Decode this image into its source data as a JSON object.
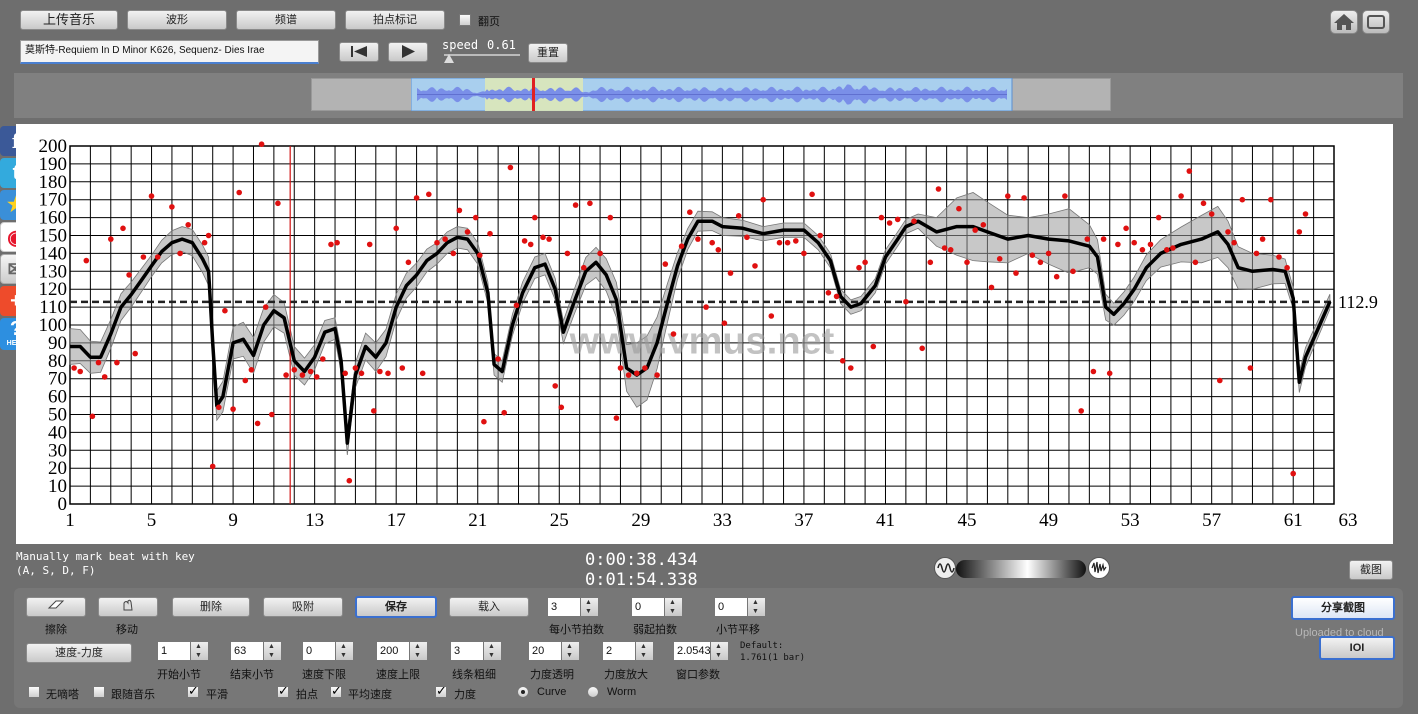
{
  "toolbar": {
    "upload_label": "上传音乐",
    "waveform_label": "波形",
    "spectrum_label": "频谱",
    "tap_mark_label": "拍点标记",
    "page_flip_label": "翻页",
    "song_title": "莫斯特-Requiem In D Minor K626, Sequenz- Dies Irae",
    "speed_label": "speed",
    "speed_value": "0.61",
    "reset_label": "重置"
  },
  "chart_data": {
    "type": "scatter",
    "title": "",
    "xlabel": "",
    "ylabel": "",
    "xlim": [
      1,
      63
    ],
    "ylim": [
      0,
      200
    ],
    "x_ticks": [
      1,
      5,
      9,
      13,
      17,
      21,
      25,
      29,
      33,
      37,
      41,
      45,
      49,
      53,
      57,
      61,
      63
    ],
    "y_ticks": [
      0,
      10,
      20,
      30,
      40,
      50,
      60,
      70,
      80,
      90,
      100,
      110,
      120,
      130,
      140,
      150,
      160,
      170,
      180,
      190,
      200
    ],
    "mean_line": 112.9,
    "mean_label": "112.9",
    "cursor_x": 11.8,
    "watermark": "www.vmus.net",
    "smooth_curve": [
      [
        1,
        88
      ],
      [
        1.5,
        88
      ],
      [
        2,
        82
      ],
      [
        2.5,
        82
      ],
      [
        3,
        95
      ],
      [
        3.5,
        110
      ],
      [
        4,
        117
      ],
      [
        4.5,
        125
      ],
      [
        5,
        133
      ],
      [
        5.5,
        141
      ],
      [
        6,
        146
      ],
      [
        6.5,
        148
      ],
      [
        7,
        146
      ],
      [
        7.5,
        137
      ],
      [
        7.8,
        130
      ],
      [
        8,
        90
      ],
      [
        8.2,
        55
      ],
      [
        8.5,
        60
      ],
      [
        9,
        90
      ],
      [
        9.5,
        92
      ],
      [
        10,
        83
      ],
      [
        10.5,
        100
      ],
      [
        11,
        108
      ],
      [
        11.5,
        104
      ],
      [
        12,
        80
      ],
      [
        12.5,
        74
      ],
      [
        13,
        82
      ],
      [
        13.5,
        96
      ],
      [
        14,
        98
      ],
      [
        14.3,
        80
      ],
      [
        14.6,
        34
      ],
      [
        15,
        72
      ],
      [
        15.5,
        88
      ],
      [
        16,
        82
      ],
      [
        16.5,
        90
      ],
      [
        17,
        110
      ],
      [
        17.5,
        122
      ],
      [
        18,
        128
      ],
      [
        18.5,
        136
      ],
      [
        19,
        140
      ],
      [
        19.5,
        146
      ],
      [
        20,
        149
      ],
      [
        20.5,
        148
      ],
      [
        21,
        140
      ],
      [
        21.5,
        118
      ],
      [
        21.8,
        78
      ],
      [
        22.2,
        74
      ],
      [
        22.7,
        100
      ],
      [
        23.2,
        118
      ],
      [
        23.8,
        132
      ],
      [
        24.3,
        134
      ],
      [
        24.8,
        120
      ],
      [
        25.2,
        96
      ],
      [
        25.7,
        112
      ],
      [
        26.3,
        130
      ],
      [
        26.8,
        135
      ],
      [
        27.3,
        128
      ],
      [
        27.8,
        114
      ],
      [
        28.3,
        76
      ],
      [
        28.8,
        72
      ],
      [
        29.3,
        76
      ],
      [
        29.8,
        90
      ],
      [
        30.3,
        112
      ],
      [
        30.8,
        133
      ],
      [
        31.3,
        148
      ],
      [
        31.8,
        158
      ],
      [
        32.5,
        158
      ],
      [
        33,
        155
      ],
      [
        34,
        154
      ],
      [
        35,
        151
      ],
      [
        36,
        153
      ],
      [
        37,
        153
      ],
      [
        37.7,
        146
      ],
      [
        38.3,
        136
      ],
      [
        38.8,
        116
      ],
      [
        39.3,
        110
      ],
      [
        39.8,
        112
      ],
      [
        40.5,
        122
      ],
      [
        41,
        138
      ],
      [
        41.6,
        148
      ],
      [
        42,
        155
      ],
      [
        42.6,
        158
      ],
      [
        43.5,
        152
      ],
      [
        44.5,
        155
      ],
      [
        45.3,
        155
      ],
      [
        46,
        152
      ],
      [
        47,
        148
      ],
      [
        48,
        150
      ],
      [
        49,
        148
      ],
      [
        50,
        147
      ],
      [
        51,
        144
      ],
      [
        51.4,
        138
      ],
      [
        51.8,
        110
      ],
      [
        52.2,
        106
      ],
      [
        52.7,
        112
      ],
      [
        53.2,
        120
      ],
      [
        53.8,
        132
      ],
      [
        54.5,
        140
      ],
      [
        55.5,
        145
      ],
      [
        56.5,
        148
      ],
      [
        57.3,
        152
      ],
      [
        57.8,
        145
      ],
      [
        58.3,
        132
      ],
      [
        59,
        130
      ],
      [
        60,
        131
      ],
      [
        60.6,
        130
      ],
      [
        61,
        115
      ],
      [
        61.3,
        68
      ],
      [
        61.6,
        82
      ],
      [
        62.3,
        100
      ],
      [
        62.8,
        113
      ]
    ],
    "band_half_width": [
      [
        1,
        10
      ],
      [
        5,
        6
      ],
      [
        8,
        8
      ],
      [
        10,
        10
      ],
      [
        12,
        8
      ],
      [
        14,
        6
      ],
      [
        16,
        8
      ],
      [
        19,
        6
      ],
      [
        21,
        6
      ],
      [
        23,
        6
      ],
      [
        25,
        6
      ],
      [
        28,
        10
      ],
      [
        29,
        20
      ],
      [
        31,
        6
      ],
      [
        35,
        4
      ],
      [
        38,
        4
      ],
      [
        41,
        4
      ],
      [
        43,
        4
      ],
      [
        45,
        20
      ],
      [
        48,
        10
      ],
      [
        50,
        18
      ],
      [
        52,
        6
      ],
      [
        55,
        8
      ],
      [
        57,
        15
      ],
      [
        59,
        10
      ],
      [
        61,
        6
      ],
      [
        63,
        4
      ]
    ],
    "points": [
      [
        1.2,
        76
      ],
      [
        1.5,
        74
      ],
      [
        1.8,
        136
      ],
      [
        2.1,
        49
      ],
      [
        2.4,
        79
      ],
      [
        2.7,
        71
      ],
      [
        3.0,
        148
      ],
      [
        3.3,
        79
      ],
      [
        3.6,
        154
      ],
      [
        3.9,
        128
      ],
      [
        4.2,
        84
      ],
      [
        4.6,
        138
      ],
      [
        5.0,
        172
      ],
      [
        5.3,
        138
      ],
      [
        6.0,
        166
      ],
      [
        6.4,
        140
      ],
      [
        6.8,
        156
      ],
      [
        7.6,
        146
      ],
      [
        7.8,
        150
      ],
      [
        8.0,
        21
      ],
      [
        8.3,
        54
      ],
      [
        8.6,
        108
      ],
      [
        9.0,
        53
      ],
      [
        9.3,
        174
      ],
      [
        9.6,
        69
      ],
      [
        9.9,
        75
      ],
      [
        10.2,
        45
      ],
      [
        10.4,
        201
      ],
      [
        10.6,
        110
      ],
      [
        10.9,
        50
      ],
      [
        11.2,
        168
      ],
      [
        11.6,
        72
      ],
      [
        12.0,
        75
      ],
      [
        12.4,
        72
      ],
      [
        12.8,
        74
      ],
      [
        13.1,
        71
      ],
      [
        13.4,
        81
      ],
      [
        13.8,
        145
      ],
      [
        14.1,
        146
      ],
      [
        14.5,
        73
      ],
      [
        14.7,
        13
      ],
      [
        15.0,
        76
      ],
      [
        15.3,
        73
      ],
      [
        15.7,
        145
      ],
      [
        15.9,
        52
      ],
      [
        16.2,
        74
      ],
      [
        16.6,
        73
      ],
      [
        17.0,
        154
      ],
      [
        17.3,
        76
      ],
      [
        17.6,
        135
      ],
      [
        18.0,
        171
      ],
      [
        18.3,
        73
      ],
      [
        18.6,
        173
      ],
      [
        19.0,
        146
      ],
      [
        19.4,
        148
      ],
      [
        19.8,
        140
      ],
      [
        20.1,
        164
      ],
      [
        20.5,
        152
      ],
      [
        20.9,
        160
      ],
      [
        21.1,
        139
      ],
      [
        21.3,
        46
      ],
      [
        21.6,
        151
      ],
      [
        22.0,
        81
      ],
      [
        22.3,
        51
      ],
      [
        22.6,
        188
      ],
      [
        22.9,
        111
      ],
      [
        23.3,
        147
      ],
      [
        23.6,
        145
      ],
      [
        23.8,
        160
      ],
      [
        24.2,
        149
      ],
      [
        24.5,
        148
      ],
      [
        24.8,
        66
      ],
      [
        25.1,
        54
      ],
      [
        25.4,
        140
      ],
      [
        25.8,
        167
      ],
      [
        26.2,
        132
      ],
      [
        26.5,
        168
      ],
      [
        27.0,
        140
      ],
      [
        27.5,
        160
      ],
      [
        27.8,
        48
      ],
      [
        28.0,
        76
      ],
      [
        28.4,
        72
      ],
      [
        28.8,
        73
      ],
      [
        29.2,
        76
      ],
      [
        29.8,
        72
      ],
      [
        30.2,
        134
      ],
      [
        30.6,
        95
      ],
      [
        31.0,
        144
      ],
      [
        31.4,
        163
      ],
      [
        31.8,
        148
      ],
      [
        32.2,
        110
      ],
      [
        32.5,
        146
      ],
      [
        32.8,
        142
      ],
      [
        33.1,
        101
      ],
      [
        33.4,
        129
      ],
      [
        33.8,
        161
      ],
      [
        34.2,
        149
      ],
      [
        34.6,
        133
      ],
      [
        35.0,
        170
      ],
      [
        35.4,
        105
      ],
      [
        35.8,
        146
      ],
      [
        36.2,
        146
      ],
      [
        36.6,
        147
      ],
      [
        37.0,
        140
      ],
      [
        37.4,
        173
      ],
      [
        37.8,
        150
      ],
      [
        38.2,
        118
      ],
      [
        38.6,
        116
      ],
      [
        38.9,
        80
      ],
      [
        39.3,
        76
      ],
      [
        39.7,
        132
      ],
      [
        40.0,
        135
      ],
      [
        40.4,
        88
      ],
      [
        40.8,
        160
      ],
      [
        41.2,
        157
      ],
      [
        41.6,
        159
      ],
      [
        42.0,
        113
      ],
      [
        42.4,
        158
      ],
      [
        42.8,
        87
      ],
      [
        43.2,
        135
      ],
      [
        43.6,
        176
      ],
      [
        43.9,
        143
      ],
      [
        44.2,
        142
      ],
      [
        44.6,
        165
      ],
      [
        45.0,
        135
      ],
      [
        45.4,
        153
      ],
      [
        45.8,
        156
      ],
      [
        46.2,
        121
      ],
      [
        46.6,
        137
      ],
      [
        47.0,
        172
      ],
      [
        47.4,
        129
      ],
      [
        47.8,
        171
      ],
      [
        48.2,
        139
      ],
      [
        48.6,
        135
      ],
      [
        49.0,
        140
      ],
      [
        49.4,
        127
      ],
      [
        49.8,
        172
      ],
      [
        50.2,
        130
      ],
      [
        50.6,
        52
      ],
      [
        50.9,
        148
      ],
      [
        51.2,
        74
      ],
      [
        51.7,
        148
      ],
      [
        52.0,
        73
      ],
      [
        52.4,
        145
      ],
      [
        52.8,
        154
      ],
      [
        53.2,
        146
      ],
      [
        53.6,
        142
      ],
      [
        54.0,
        145
      ],
      [
        54.4,
        160
      ],
      [
        54.8,
        142
      ],
      [
        55.1,
        143
      ],
      [
        55.5,
        172
      ],
      [
        55.9,
        186
      ],
      [
        56.2,
        135
      ],
      [
        56.6,
        168
      ],
      [
        57.0,
        162
      ],
      [
        57.4,
        69
      ],
      [
        57.8,
        152
      ],
      [
        58.1,
        146
      ],
      [
        58.5,
        170
      ],
      [
        58.9,
        76
      ],
      [
        59.2,
        140
      ],
      [
        59.5,
        148
      ],
      [
        59.9,
        170
      ],
      [
        60.3,
        138
      ],
      [
        60.7,
        132
      ],
      [
        61.0,
        17
      ],
      [
        61.3,
        152
      ],
      [
        61.6,
        162
      ]
    ]
  },
  "status": {
    "hint_line1": "Manually mark beat with key",
    "hint_line2": "(A, S, D, F)",
    "time_current": "0:00:38.434",
    "time_total": "0:01:54.338",
    "screenshot_label": "截图"
  },
  "controls": {
    "erase_label": "擦除",
    "move_label": "移动",
    "delete_label": "删除",
    "snap_label": "吸附",
    "save_label": "保存",
    "load_label": "载入",
    "beats_per_bar_value": "3",
    "beats_per_bar_label": "每小节拍数",
    "pickup_value": "0",
    "pickup_label": "弱起拍数",
    "bar_shift_value": "0",
    "bar_shift_label": "小节平移",
    "tempo_dynamics_label": "速度-力度",
    "start_bar_value": "1",
    "start_bar_label": "开始小节",
    "end_bar_value": "63",
    "end_bar_label": "结束小节",
    "tempo_min_value": "0",
    "tempo_min_label": "速度下限",
    "tempo_max_value": "200",
    "tempo_max_label": "速度上限",
    "line_width_value": "3",
    "line_width_label": "线条粗细",
    "dyn_transparency_value": "20",
    "dyn_transparency_label": "力度透明",
    "dyn_scale_value": "2",
    "dyn_scale_label": "力度放大",
    "window_value": "2.0543",
    "window_label": "窗口参数",
    "default_line1": "Default:",
    "default_line2": "1.761(1 bar)",
    "share_label": "分享截图",
    "uploaded_label": "Uploaded to cloud",
    "ioi_label": "IOI",
    "no_metronome_label": "无嘀嗒",
    "follow_music_label": "跟随音乐",
    "smooth_label": "平滑",
    "beat_point_label": "拍点",
    "avg_tempo_label": "平均速度",
    "dynamics_label": "力度",
    "curve_label": "Curve",
    "worm_label": "Worm"
  },
  "sidebar": {
    "help_label": "HELP"
  }
}
